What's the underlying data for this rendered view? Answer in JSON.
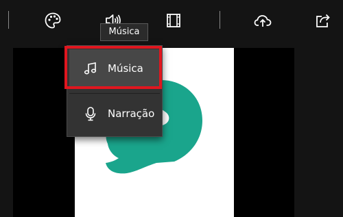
{
  "toolbar": {
    "buttons": [
      {
        "name": "themes",
        "icon": "palette-icon"
      },
      {
        "name": "audio",
        "icon": "speaker-icon"
      },
      {
        "name": "filters",
        "icon": "film-frame-icon"
      },
      {
        "name": "upload",
        "icon": "cloud-upload-icon"
      },
      {
        "name": "share",
        "icon": "share-icon"
      }
    ]
  },
  "tooltip": {
    "text": "Música"
  },
  "audio_menu": {
    "items": [
      {
        "label": "Música",
        "icon": "music-note-icon",
        "selected": true
      },
      {
        "label": "Narração",
        "icon": "microphone-icon",
        "selected": false
      }
    ]
  },
  "colors": {
    "background": "#141414",
    "menu_background": "#333333",
    "menu_selected": "#474747",
    "highlight": "#e0161f",
    "logo_teal": "#1aa58c",
    "icon": "#ffffff"
  }
}
